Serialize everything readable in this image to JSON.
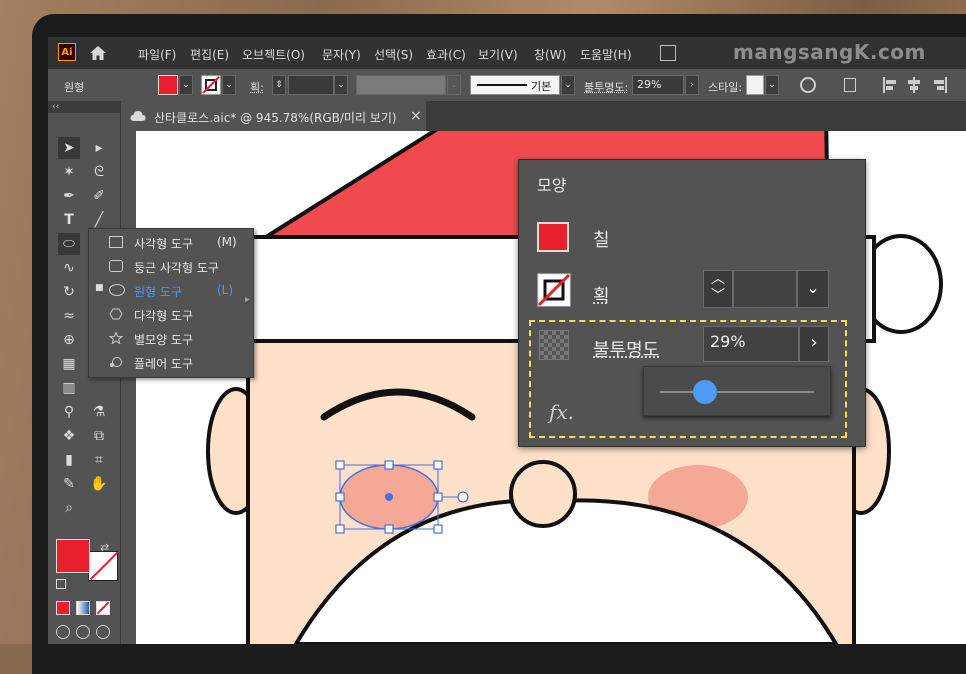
{
  "menubar": {
    "logo": "Ai",
    "items": [
      "파일(F)",
      "편집(E)",
      "오브젝트(O)",
      "문자(Y)",
      "선택(S)",
      "효과(C)",
      "보기(V)",
      "창(W)",
      "도움말(H)"
    ],
    "watermark": "mangsangK.com"
  },
  "controlbar": {
    "object_type": "원형",
    "stroke_label": "획:",
    "stroke_style_label": "기본",
    "opacity_label": "불투명도:",
    "opacity_value": "29%",
    "style_label": "스타일:"
  },
  "tab": {
    "title": "산타클로스.aic* @ 945.78%(RGB/미리 보기)",
    "close": "×"
  },
  "tools_header": "‹‹",
  "flyout": {
    "items": [
      {
        "label": "사각형 도구",
        "key": "(M)",
        "selected": false
      },
      {
        "label": "둥근 사각형 도구",
        "key": "",
        "selected": false
      },
      {
        "label": "원형 도구",
        "key": "(L)",
        "selected": true
      },
      {
        "label": "다각형 도구",
        "key": "",
        "selected": false
      },
      {
        "label": "별모양 도구",
        "key": "",
        "selected": false
      },
      {
        "label": "플레어 도구",
        "key": "",
        "selected": false
      }
    ]
  },
  "appearance": {
    "title": "모양",
    "fill_label": "칠",
    "stroke_label": "획",
    "opacity_label": "불투명도",
    "opacity_value": "29%",
    "fx_label": "fx.",
    "slider_fraction": 0.29
  },
  "colors": {
    "fill": "#e8202d",
    "hat": "#f04a4f",
    "skin": "#ffe0c9",
    "cheek": "#f5a896",
    "selection": "#4a6ee0",
    "highlight_box": "#f0e24a",
    "slider_knob": "#4d9bf5"
  }
}
